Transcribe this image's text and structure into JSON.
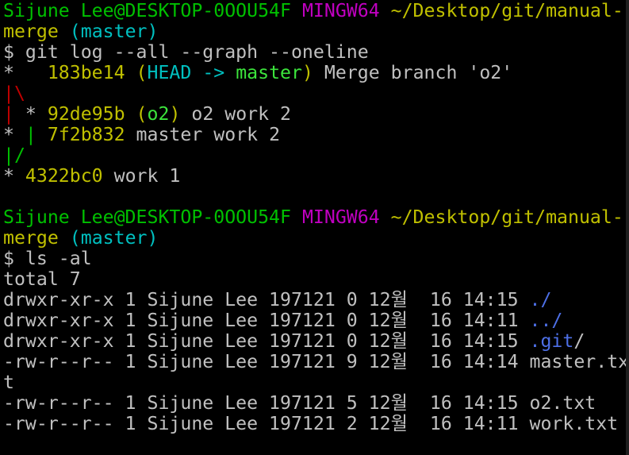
{
  "colors": {
    "background": "#000000",
    "default_text": "#c0c0c0",
    "user_host": "#00c000",
    "mingw": "#c000c0",
    "path": "#c0c000",
    "branch": "#00c0c0",
    "graph_red": "#c00000",
    "graph_green": "#00c000",
    "hash": "#c0c000",
    "head_ref": "#00c0c0",
    "master_ref": "#3ce43c",
    "o2_ref": "#3ce43c",
    "dir_blue": "#4d6fe6"
  },
  "terminal": {
    "prompt1": {
      "user_host": "Sijune Lee@DESKTOP-0OOU54F",
      "system": "MINGW64",
      "path_part1": "~/Desktop/git/manual-",
      "path_part2": "merge",
      "branch": "(master)"
    },
    "command1": "$ git log --all --graph --oneline",
    "graph": [
      {
        "marker": "*   ",
        "hash": "183be14",
        "ref_open": "(",
        "ref_head": "HEAD -> ",
        "ref_master": "master",
        "ref_close": ")",
        "message": " Merge branch 'o2'"
      },
      {
        "edge": "|\\"
      },
      {
        "edge_left": "|",
        "marker": " * ",
        "hash": "92de95b",
        "ref_open": " (",
        "ref_name": "o2",
        "ref_close": ")",
        "message": " o2 work 2"
      },
      {
        "marker": "* ",
        "edge_right": "|",
        "hash": "7f2b832",
        "message": " master work 2"
      },
      {
        "edge": "|/"
      },
      {
        "marker": "* ",
        "hash": "4322bc0",
        "message": " work 1"
      }
    ],
    "prompt2": {
      "user_host": "Sijune Lee@DESKTOP-0OOU54F",
      "system": "MINGW64",
      "path_part1": "~/Desktop/git/manual-",
      "path_part2": "merge",
      "branch": "(master)"
    },
    "command2": "$ ls -al",
    "total": "total 7",
    "listing": [
      {
        "prefix": "drwxr-xr-x 1 Sijune Lee 197121 0 12월  16 14:15 ",
        "name": "./",
        "name_suffix": "",
        "is_dir": true
      },
      {
        "prefix": "drwxr-xr-x 1 Sijune Lee 197121 0 12월  16 14:11 ",
        "name": "../",
        "name_suffix": "",
        "is_dir": true
      },
      {
        "prefix": "drwxr-xr-x 1 Sijune Lee 197121 0 12월  16 14:15 ",
        "name": ".git",
        "name_suffix": "/",
        "is_dir": true
      },
      {
        "prefix": "-rw-r--r-- 1 Sijune Lee 197121 9 12월  16 14:14 ",
        "name": "master.tx",
        "name_suffix": "",
        "is_dir": false
      },
      {
        "prefix": "",
        "name": "t",
        "name_suffix": "",
        "is_dir": false
      },
      {
        "prefix": "-rw-r--r-- 1 Sijune Lee 197121 5 12월  16 14:15 ",
        "name": "o2.txt",
        "name_suffix": "",
        "is_dir": false
      },
      {
        "prefix": "-rw-r--r-- 1 Sijune Lee 197121 2 12월  16 14:11 ",
        "name": "work.txt",
        "name_suffix": "",
        "is_dir": false
      }
    ]
  }
}
